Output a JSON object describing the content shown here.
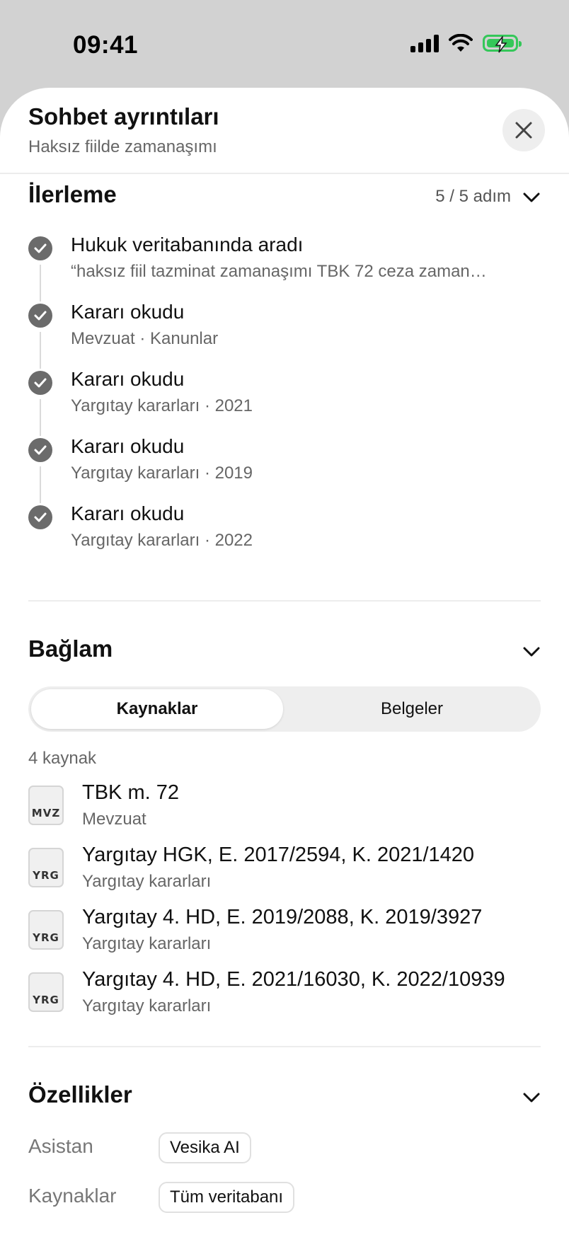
{
  "status_bar": {
    "time": "09:41"
  },
  "header": {
    "title": "Sohbet ayrıntıları",
    "subtitle": "Haksız fiilde zamanaşımı"
  },
  "progress": {
    "title": "İlerleme",
    "count": "5 / 5 adım",
    "steps": [
      {
        "title": "Hukuk veritabanında aradı",
        "detail": "“haksız fiil tazminat zamanaşımı TBK 72 ceza zaman…"
      },
      {
        "title": "Kararı okudu",
        "detail": "Mevzuat · Kanunlar"
      },
      {
        "title": "Kararı okudu",
        "detail": "Yargıtay kararları · 2021"
      },
      {
        "title": "Kararı okudu",
        "detail": "Yargıtay kararları · 2019"
      },
      {
        "title": "Kararı okudu",
        "detail": "Yargıtay kararları · 2022"
      }
    ]
  },
  "context": {
    "title": "Bağlam",
    "tabs": [
      {
        "label": "Kaynaklar",
        "active": true
      },
      {
        "label": "Belgeler",
        "active": false
      }
    ],
    "source_count": "4 kaynak",
    "sources": [
      {
        "badge": "MVZ",
        "title": "TBK m. 72",
        "subtitle": "Mevzuat"
      },
      {
        "badge": "YRG",
        "title": "Yargıtay HGK, E. 2017/2594, K. 2021/1420",
        "subtitle": "Yargıtay kararları"
      },
      {
        "badge": "YRG",
        "title": "Yargıtay 4. HD, E. 2019/2088, K. 2019/3927",
        "subtitle": "Yargıtay kararları"
      },
      {
        "badge": "YRG",
        "title": "Yargıtay 4. HD, E. 2021/16030, K. 2022/10939",
        "subtitle": "Yargıtay kararları"
      }
    ]
  },
  "properties": {
    "title": "Özellikler",
    "items": [
      {
        "label": "Asistan",
        "value": "Vesika AI"
      },
      {
        "label": "Kaynaklar",
        "value": "Tüm veritabanı"
      }
    ]
  },
  "colors": {
    "check": "#6b6b6b",
    "battery": "#34c759",
    "background": "#d2d2d2"
  },
  "icons": [
    "signal-icon",
    "wifi-icon",
    "battery-icon",
    "close-icon",
    "chevron-down-icon",
    "check-circle-icon"
  ]
}
